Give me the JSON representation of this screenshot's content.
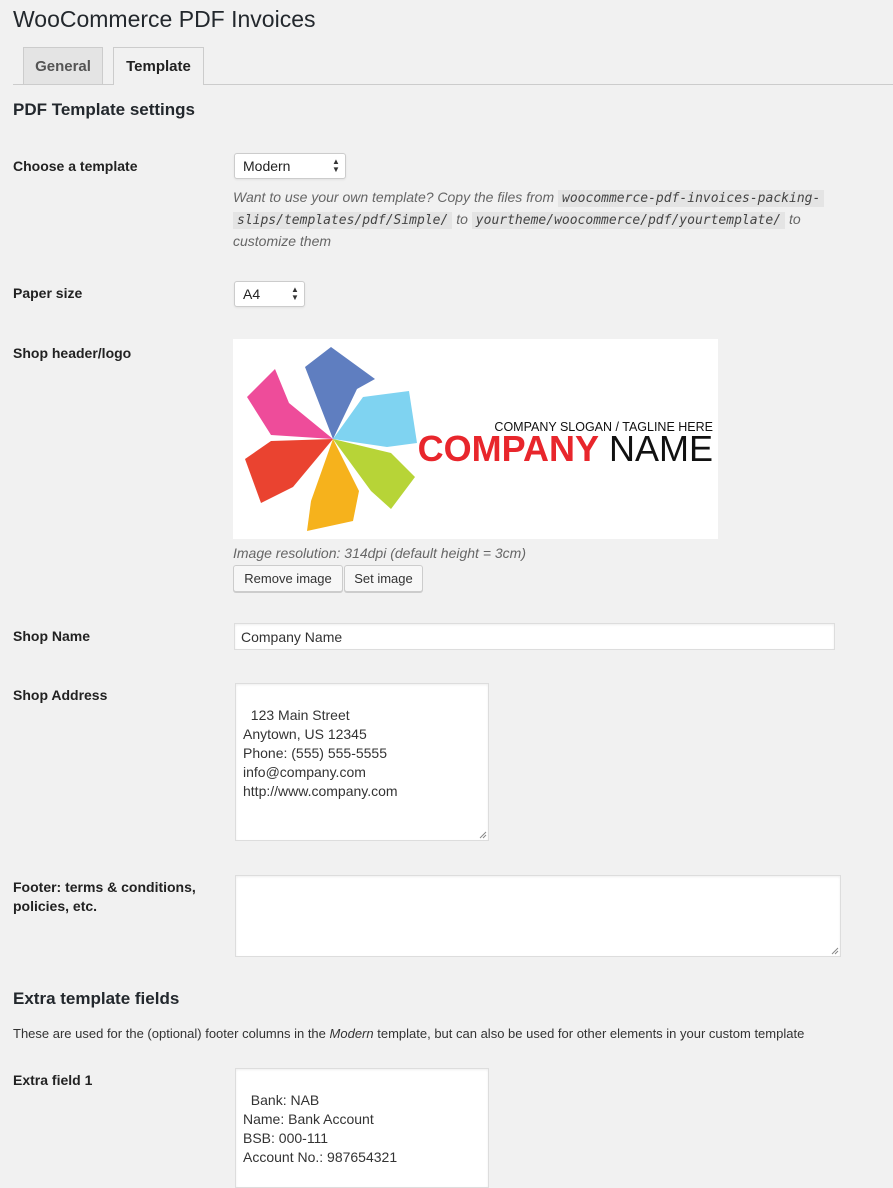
{
  "page": {
    "title": "WooCommerce PDF Invoices"
  },
  "tabs": [
    {
      "label": "General",
      "active": false
    },
    {
      "label": "Template",
      "active": true
    }
  ],
  "section1": {
    "title": "PDF Template settings"
  },
  "template": {
    "label": "Choose a template",
    "value": "Modern",
    "desc_pre": "Want to use your own template? Copy the files from",
    "code1a": "woocommerce-pdf-invoices-packing-",
    "code1b": "slips/templates/pdf/Simple/",
    "desc_to": "to",
    "code2": "yourtheme/woocommerce/pdf/yourtemplate/",
    "desc_to2": "to",
    "desc_post": "customize them"
  },
  "paper": {
    "label": "Paper size",
    "value": "A4"
  },
  "logo": {
    "label": "Shop header/logo",
    "slogan": "COMPANY SLOGAN / TAGLINE HERE",
    "company_word": "COMPANY",
    "name_word": "NAME",
    "resolution": "Image resolution: 314dpi (default height = 3cm)",
    "remove_label": "Remove image",
    "set_label": "Set image",
    "colors": {
      "red": "#e8262c",
      "pink": "#ee4c9a",
      "blue": "#5f7ec0",
      "sky": "#7fd3f1",
      "green": "#b7d437",
      "orange": "#f6b21c",
      "tomato": "#ea4330"
    }
  },
  "shop_name": {
    "label": "Shop Name",
    "value": "Company Name"
  },
  "shop_address": {
    "label": "Shop Address",
    "value": "123 Main Street\nAnytown, US 12345\nPhone: (555) 555-5555\ninfo@company.com\nhttp://www.company.com"
  },
  "footer": {
    "label_line1": "Footer: terms & conditions,",
    "label_line2": "policies, etc.",
    "value": ""
  },
  "section2": {
    "title": "Extra template fields",
    "note_pre": "These are used for the (optional) footer columns in the",
    "note_em": "Modern",
    "note_post": "template, but can also be used for other elements in your custom template"
  },
  "extra1": {
    "label": "Extra field 1",
    "value": "Bank: NAB\nName: Bank Account\nBSB: 000-111\nAccount No.: 987654321"
  }
}
